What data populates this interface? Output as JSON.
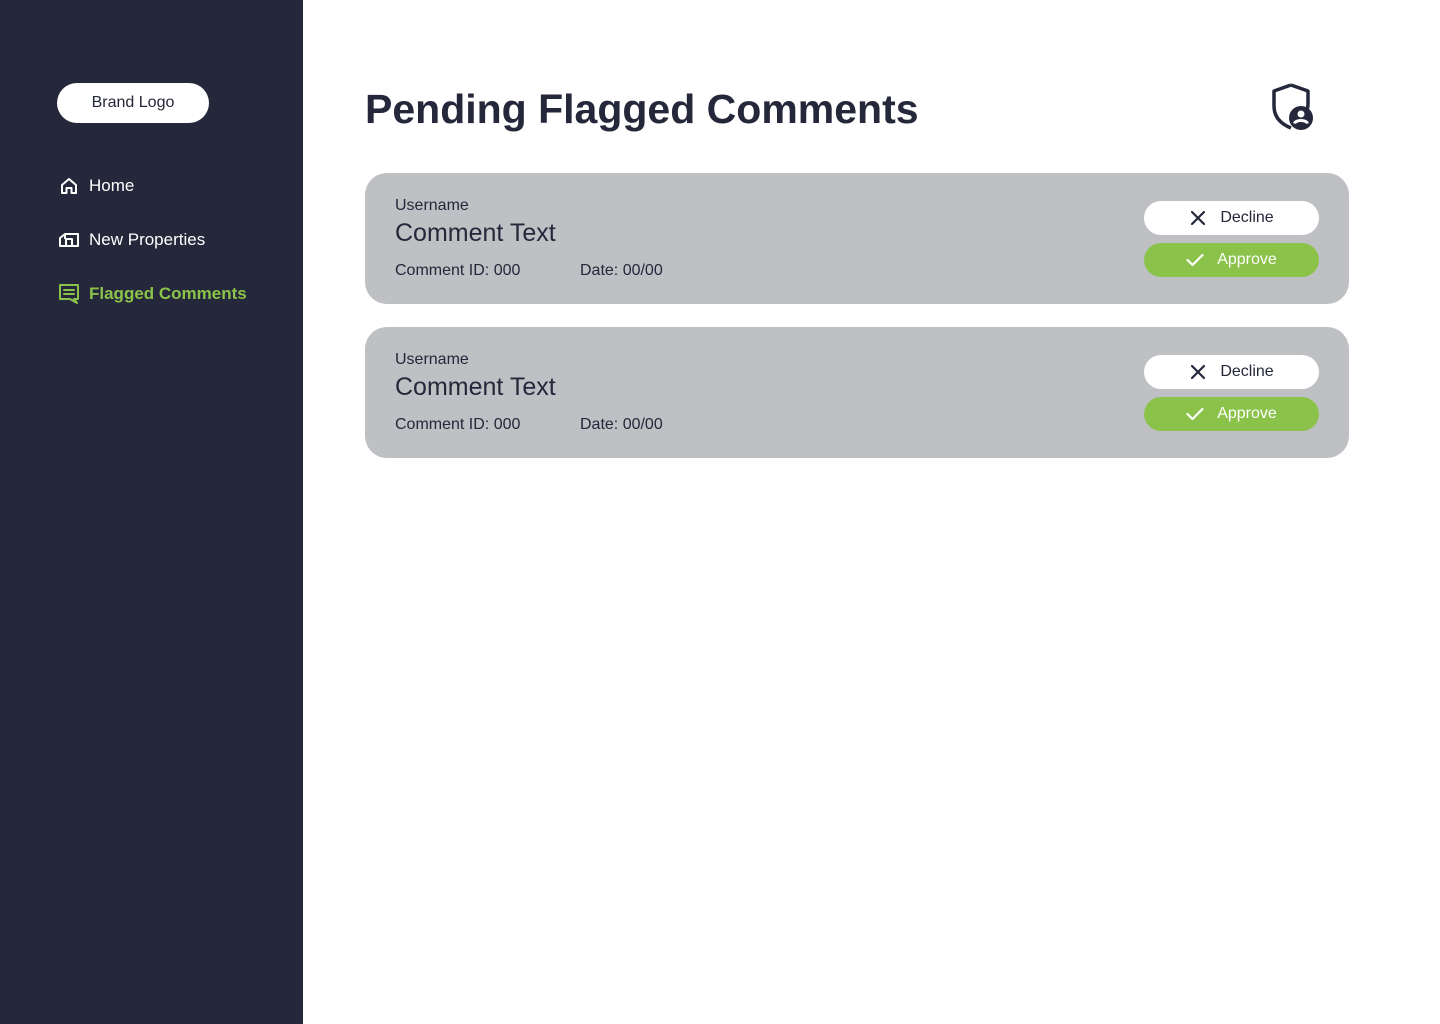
{
  "sidebar": {
    "brand_logo": "Brand Logo",
    "items": [
      {
        "label": "Home",
        "icon": "home-icon",
        "active": false
      },
      {
        "label": "New Properties",
        "icon": "property-icon",
        "active": false
      },
      {
        "label": "Flagged Comments",
        "icon": "comment-icon",
        "active": true
      }
    ]
  },
  "header": {
    "title": "Pending Flagged Comments",
    "icon": "admin-shield-icon"
  },
  "comments": [
    {
      "username": "Username",
      "text": "Comment Text",
      "comment_id": "Comment ID: 000",
      "date": "Date: 00/00",
      "decline_label": "Decline",
      "approve_label": "Approve"
    },
    {
      "username": "Username",
      "text": "Comment Text",
      "comment_id": "Comment ID: 000",
      "date": "Date: 00/00",
      "decline_label": "Decline",
      "approve_label": "Approve"
    }
  ],
  "colors": {
    "sidebar_bg": "#25273a",
    "accent": "#8bc34a",
    "card_bg": "#bfc0c4",
    "text_dark": "#25273a"
  }
}
